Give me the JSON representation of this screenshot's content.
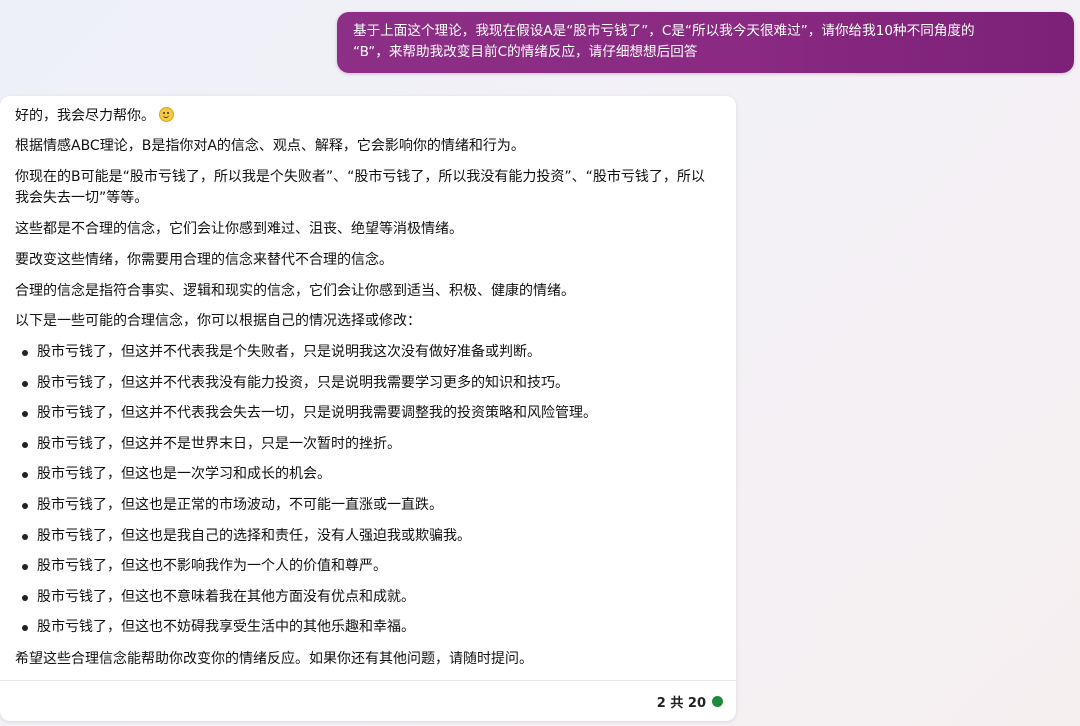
{
  "user_message": {
    "line1": "基于上面这个理论，我现在假设A是“股市亏钱了”，C是“所以我今天很难过”，请你给我10种不同角度的",
    "line2": "“B”，来帮助我改变目前C的情绪反应，请仔细想想后回答"
  },
  "bot_message": {
    "greeting": "好的，我会尽力帮你。",
    "emoji": "smiling-face-icon",
    "paragraphs": [
      "根据情感ABC理论，B是指你对A的信念、观点、解释，它会影响你的情绪和行为。",
      "你现在的B可能是“股市亏钱了，所以我是个失败者”、“股市亏钱了，所以我没有能力投资”、“股市亏钱了，所以我会失去一切”等等。",
      "这些都是不合理的信念，它们会让你感到难过、沮丧、绝望等消极情绪。",
      "要改变这些情绪，你需要用合理的信念来替代不合理的信念。",
      "合理的信念是指符合事实、逻辑和现实的信念，它们会让你感到适当、积极、健康的情绪。",
      "以下是一些可能的合理信念，你可以根据自己的情况选择或修改："
    ],
    "bullets": [
      "股市亏钱了，但这并不代表我是个失败者，只是说明我这次没有做好准备或判断。",
      "股市亏钱了，但这并不代表我没有能力投资，只是说明我需要学习更多的知识和技巧。",
      "股市亏钱了，但这并不代表我会失去一切，只是说明我需要调整我的投资策略和风险管理。",
      "股市亏钱了，但这并不是世界末日，只是一次暂时的挫折。",
      "股市亏钱了，但这也是一次学习和成长的机会。",
      "股市亏钱了，但这也是正常的市场波动，不可能一直涨或一直跌。",
      "股市亏钱了，但这也是我自己的选择和责任，没有人强迫我或欺骗我。",
      "股市亏钱了，但这也不影响我作为一个人的价值和尊严。",
      "股市亏钱了，但这也不意味着我在其他方面没有优点和成就。",
      "股市亏钱了，但这也不妨碍我享受生活中的其他乐趣和幸福。"
    ],
    "closing": "希望这些合理信念能帮助你改变你的情绪反应。如果你还有其他问题，请随时提问。"
  },
  "footer": {
    "counter": "2 共 20",
    "status_color": "#1f8a3b"
  },
  "colors": {
    "user_bubble": "#8a2a82",
    "status_dot": "#1f8a3b"
  }
}
